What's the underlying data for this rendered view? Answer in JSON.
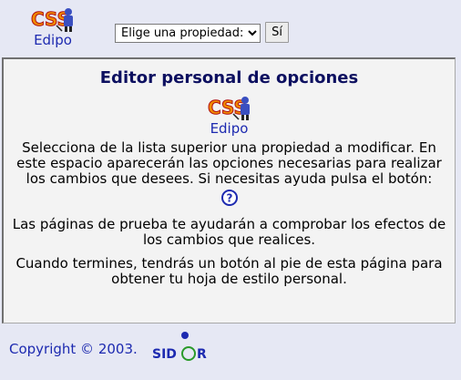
{
  "header": {
    "logo_mark": "CSS",
    "logo_label": "Edipo",
    "property_select": {
      "selected": "Elige una propiedad:"
    },
    "submit_label": "Sí"
  },
  "panel": {
    "title": "Editor personal de opciones",
    "logo_label": "Edipo",
    "intro": "Selecciona de la lista superior una propiedad a modificar. En este espacio aparecerán las opciones necesarias para realizar los cambios que desees. Si necesitas ayuda pulsa el botón:",
    "test_pages": "Las páginas de prueba te ayudarán a comprobar los efectos de los cambios que realices.",
    "finish": "Cuando termines, tendrás un botón al pie de esta página para obtener tu hoja de estilo personal."
  },
  "footer": {
    "copyright": "Copyright © 2003.",
    "brand": "SIDAR"
  },
  "colors": {
    "link": "#1d2ab0",
    "title": "#0d1060",
    "background": "#e6e8f4"
  }
}
